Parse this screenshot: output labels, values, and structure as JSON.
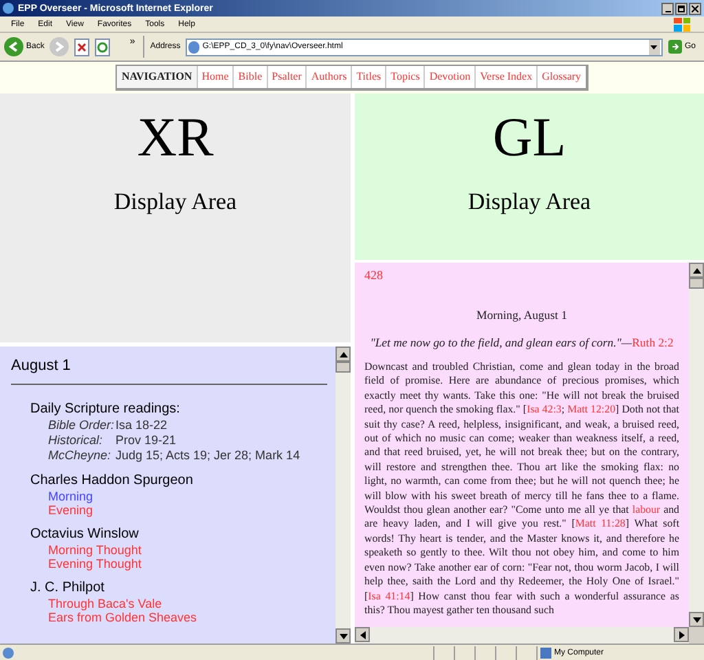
{
  "window": {
    "title": "EPP Overseer - Microsoft Internet Explorer"
  },
  "menu": [
    "File",
    "Edit",
    "View",
    "Favorites",
    "Tools",
    "Help"
  ],
  "toolbar": {
    "back": "Back",
    "overflow": "»",
    "address_label": "Address",
    "address": "G:\\EPP_CD_3_0\\fy\\nav\\Overseer.html",
    "go": "Go"
  },
  "navigation": {
    "label": "NAVIGATION",
    "links": [
      "Home",
      "Bible",
      "Psalter",
      "Authors",
      "Titles",
      "Topics",
      "Devotion",
      "Verse Index",
      "Glossary"
    ]
  },
  "xr_pane": {
    "title": "XR",
    "subtitle": "Display Area"
  },
  "gl_pane": {
    "title": "GL",
    "subtitle": "Display Area"
  },
  "daily": {
    "date": "August 1",
    "readings_heading": "Daily Scripture readings:",
    "readings": [
      {
        "label": "Bible Order:",
        "value": "Isa 18-22"
      },
      {
        "label": "Historical:",
        "value": "Prov 19-21"
      },
      {
        "label": "McCheyne:",
        "value": "Judg 15; Acts 19; Jer 28; Mark 14"
      }
    ],
    "authors": [
      {
        "name": "Charles Haddon Spurgeon",
        "links": [
          {
            "text": "Morning",
            "selected": true
          },
          {
            "text": "Evening",
            "selected": false
          }
        ]
      },
      {
        "name": "Octavius Winslow",
        "links": [
          {
            "text": "Morning Thought",
            "selected": false
          },
          {
            "text": "Evening Thought",
            "selected": false
          }
        ]
      },
      {
        "name": "J. C. Philpot",
        "links": [
          {
            "text": "Through Baca's Vale",
            "selected": false
          },
          {
            "text": "Ears from Golden Sheaves",
            "selected": false
          }
        ]
      }
    ]
  },
  "reading": {
    "page_number": "428",
    "heading": "Morning, August 1",
    "epigraph": "\"Let me now go to the field, and glean ears of corn.\"—",
    "epigraph_ref": "Ruth 2:2",
    "body": [
      {
        "kind": "text",
        "text": "Downcast and troubled Christian, come and glean today in the broad field of promise. Here are abundance of precious promises, which exactly meet thy wants. Take this one: \"He will not break the bruised reed, nor quench the smoking flax.\" ["
      },
      {
        "kind": "link",
        "text": "Isa 42:3"
      },
      {
        "kind": "text",
        "text": "; "
      },
      {
        "kind": "link",
        "text": "Matt 12:20"
      },
      {
        "kind": "text",
        "text": "] Doth not that suit thy case? A reed, helpless, insignificant, and weak, a bruised reed, out of which no music can come; weaker than weakness itself, a reed, and that reed bruised, yet, he will not break thee; but on the contrary, will restore and strengthen thee. Thou art like the smoking flax: no light, no warmth, can come from thee; but he will not quench thee; he will blow with his sweet breath of mercy till he fans thee to a flame. Wouldst thou glean another ear? \"Come unto me all ye that "
      },
      {
        "kind": "link",
        "text": "labour"
      },
      {
        "kind": "text",
        "text": " and are heavy laden, and I will give you rest.\" ["
      },
      {
        "kind": "link",
        "text": "Matt 11:28"
      },
      {
        "kind": "text",
        "text": "] What soft words! Thy heart is tender, and the Master knows it, and therefore he speaketh so gently to thee. Wilt thou not obey him, and come to him even now? Take another ear of corn: \"Fear not, thou worm Jacob, I will help thee, saith the Lord and thy Redeemer, the Holy One of Israel.\" ["
      },
      {
        "kind": "link",
        "text": "Isa 41:14"
      },
      {
        "kind": "text",
        "text": "] How canst thou fear with such a wonderful assurance as this? Thou mayest gather ten thousand such"
      }
    ]
  },
  "status_bar": {
    "zone": "My Computer"
  }
}
